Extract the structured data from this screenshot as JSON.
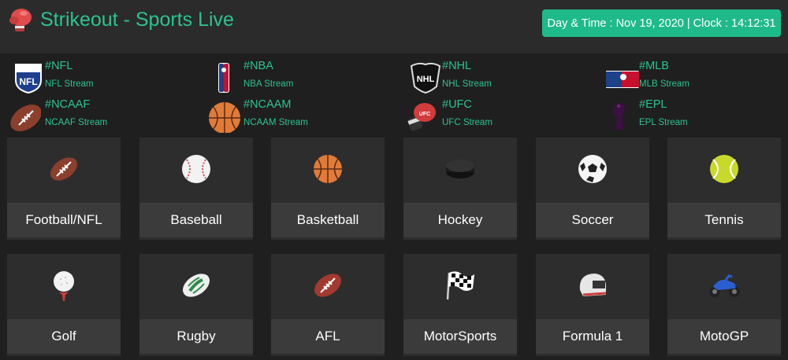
{
  "header": {
    "title": "Strikeout - Sports Live",
    "logo_icon": "boxing-glove-icon",
    "clock_prefix": "Day & Time : ",
    "date": "Nov 19, 2020",
    "clock_separator": " | Clock : ",
    "time": "14:12:31"
  },
  "leagues": [
    {
      "tag": "#NFL",
      "sub": "NFL Stream",
      "icon": "nfl-logo-icon"
    },
    {
      "tag": "#NBA",
      "sub": "NBA Stream",
      "icon": "nba-logo-icon"
    },
    {
      "tag": "#NHL",
      "sub": "NHL Stream",
      "icon": "nhl-logo-icon"
    },
    {
      "tag": "#MLB",
      "sub": "MLB Stream",
      "icon": "mlb-logo-icon"
    },
    {
      "tag": "#NCAAF",
      "sub": "NCAAF Stream",
      "icon": "american-football-icon"
    },
    {
      "tag": "#NCAAM",
      "sub": "NCAAM Stream",
      "icon": "basketball-icon"
    },
    {
      "tag": "#UFC",
      "sub": "UFC Stream",
      "icon": "ufc-glove-icon"
    },
    {
      "tag": "#EPL",
      "sub": "EPL Stream",
      "icon": "epl-lion-icon"
    }
  ],
  "sports": [
    {
      "label": "Football/NFL",
      "icon": "american-football-icon"
    },
    {
      "label": "Baseball",
      "icon": "baseball-icon"
    },
    {
      "label": "Basketball",
      "icon": "basketball-icon"
    },
    {
      "label": "Hockey",
      "icon": "hockey-puck-icon"
    },
    {
      "label": "Soccer",
      "icon": "soccer-ball-icon"
    },
    {
      "label": "Tennis",
      "icon": "tennis-ball-icon"
    },
    {
      "label": "Golf",
      "icon": "golf-ball-icon"
    },
    {
      "label": "Rugby",
      "icon": "rugby-ball-icon"
    },
    {
      "label": "AFL",
      "icon": "afl-ball-icon"
    },
    {
      "label": "MotorSports",
      "icon": "checkered-flag-icon"
    },
    {
      "label": "Formula 1",
      "icon": "racing-helmet-icon"
    },
    {
      "label": "MotoGP",
      "icon": "motorcycle-icon"
    }
  ],
  "colors": {
    "accent": "#2bc48f",
    "clock_bg": "#1fba8a",
    "tile_bg": "#2d2d2d",
    "label_bg": "#3b3b3b",
    "page_bg": "#1f1f1f"
  }
}
